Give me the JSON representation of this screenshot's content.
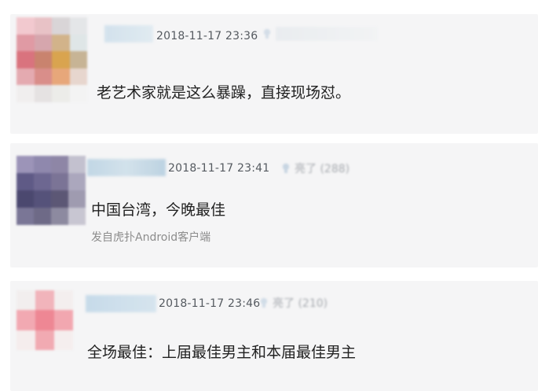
{
  "comments": [
    {
      "timestamp": "2018-11-17 23:36",
      "text": "老艺术家就是这么暴躁，直接现场怼。",
      "source": "",
      "like_label": ""
    },
    {
      "timestamp": "2018-11-17 23:41",
      "text": "中国台湾，今晚最佳",
      "source": "发自虎扑Android客户端",
      "like_label": "亮了 (288)"
    },
    {
      "timestamp": "2018-11-17 23:46",
      "text": "全场最佳：上届最佳男主和本届最佳男主",
      "source": "",
      "like_label": "亮了 (210)"
    }
  ],
  "icons": {
    "like": "lightbulb-icon"
  },
  "colors": {
    "card_background": "#f5f5f6",
    "text": "#222222",
    "meta_text": "#555a60",
    "source_text": "#8c8c8c"
  }
}
